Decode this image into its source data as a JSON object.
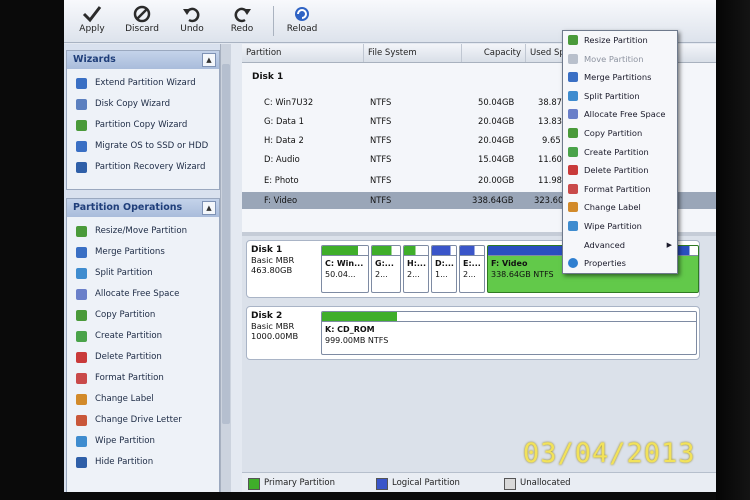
{
  "toolbar": {
    "buttons": [
      {
        "label": "Apply",
        "icon": "checkmark-icon"
      },
      {
        "label": "Discard",
        "icon": "discard-icon"
      },
      {
        "label": "Undo",
        "icon": "undo-icon"
      },
      {
        "label": "Redo",
        "icon": "redo-icon"
      },
      {
        "label": "Reload",
        "icon": "reload-icon"
      }
    ]
  },
  "wizards": {
    "title": "Wizards",
    "items": [
      {
        "label": "Extend Partition Wizard"
      },
      {
        "label": "Disk Copy Wizard"
      },
      {
        "label": "Partition Copy Wizard"
      },
      {
        "label": "Migrate OS to SSD or HDD"
      },
      {
        "label": "Partition Recovery Wizard"
      }
    ]
  },
  "operations": {
    "title": "Partition Operations",
    "items": [
      {
        "label": "Resize/Move Partition"
      },
      {
        "label": "Merge Partitions"
      },
      {
        "label": "Split Partition"
      },
      {
        "label": "Allocate Free Space"
      },
      {
        "label": "Copy Partition"
      },
      {
        "label": "Create Partition"
      },
      {
        "label": "Delete Partition"
      },
      {
        "label": "Format Partition"
      },
      {
        "label": "Change Label"
      },
      {
        "label": "Change Drive Letter"
      },
      {
        "label": "Wipe Partition"
      },
      {
        "label": "Hide Partition"
      }
    ]
  },
  "table": {
    "columns": [
      "Partition",
      "File System",
      "Capacity",
      "Used Space"
    ],
    "disk_label": "Disk 1",
    "rows": [
      {
        "partition": "C: Win7U32",
        "fs": "NTFS",
        "capacity": "50.04GB",
        "used": "38.87"
      },
      {
        "partition": "G: Data 1",
        "fs": "NTFS",
        "capacity": "20.04GB",
        "used": "13.83"
      },
      {
        "partition": "H: Data 2",
        "fs": "NTFS",
        "capacity": "20.04GB",
        "used": "9.65"
      },
      {
        "partition": "D: Audio",
        "fs": "NTFS",
        "capacity": "15.04GB",
        "used": "11.60"
      },
      {
        "partition": "E: Photo",
        "fs": "NTFS",
        "capacity": "20.00GB",
        "used": "11.98"
      },
      {
        "partition": "F: Video",
        "fs": "NTFS",
        "capacity": "338.64GB",
        "used": "323.60"
      }
    ]
  },
  "disks": [
    {
      "name": "Disk 1",
      "type": "Basic MBR",
      "size": "463.80GB",
      "partitions": [
        {
          "label": "C: Win...",
          "sub": "50.04...",
          "kind": "primary",
          "fill": 0.78
        },
        {
          "label": "G:...",
          "sub": "2...",
          "kind": "primary",
          "fill": 0.69
        },
        {
          "label": "H:...",
          "sub": "2...",
          "kind": "primary",
          "fill": 0.48
        },
        {
          "label": "D:...",
          "sub": "1...",
          "kind": "logical",
          "fill": 0.77
        },
        {
          "label": "E:...",
          "sub": "2...",
          "kind": "logical",
          "fill": 0.6
        },
        {
          "label": "F: Video",
          "sub": "338.64GB NTFS",
          "kind": "selected",
          "fill": 0.96
        }
      ]
    },
    {
      "name": "Disk 2",
      "type": "Basic MBR",
      "size": "1000.00MB",
      "partitions": [
        {
          "label": "K: CD_ROM",
          "sub": "999.00MB NTFS",
          "kind": "primary",
          "fill": 0.2
        }
      ]
    }
  ],
  "legend": [
    {
      "label": "Primary Partition",
      "color": "#3fae2a"
    },
    {
      "label": "Logical Partition",
      "color": "#3a55c9"
    },
    {
      "label": "Unallocated",
      "color": "#d8d8d8"
    }
  ],
  "context_menu": {
    "items": [
      {
        "label": "Resize Partition",
        "enabled": true
      },
      {
        "label": "Move Partition",
        "enabled": false
      },
      {
        "label": "Merge Partitions",
        "enabled": true
      },
      {
        "label": "Split Partition",
        "enabled": true
      },
      {
        "label": "Allocate Free Space",
        "enabled": true
      },
      {
        "label": "Copy Partition",
        "enabled": true
      },
      {
        "label": "Create Partition",
        "enabled": true
      },
      {
        "label": "Delete Partition",
        "enabled": true
      },
      {
        "label": "Format Partition",
        "enabled": true
      },
      {
        "label": "Change Label",
        "enabled": true
      },
      {
        "label": "Wipe Partition",
        "enabled": true
      },
      {
        "label": "Advanced",
        "enabled": true,
        "submenu": true
      },
      {
        "label": "Properties",
        "enabled": true
      }
    ]
  },
  "photo_datestamp": "03/04/2013",
  "colors": {
    "primary": "#3fae2a",
    "logical": "#3a55c9",
    "selected_partition": "#62c94a",
    "selection_row": "#9aa6b8",
    "datestamp": "#f2e25a"
  }
}
